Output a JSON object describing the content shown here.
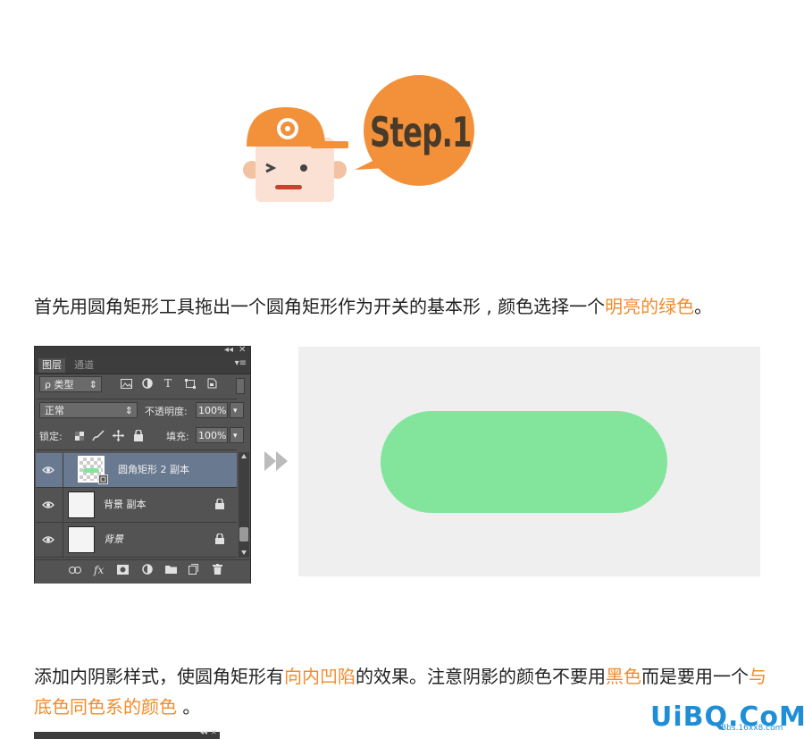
{
  "header": {
    "bubble_text": "Step.1"
  },
  "paragraph1": {
    "text_before": "首先用圆角矩形工具拖出一个圆角矩形作为开关的基本形 , 颜色选择一个",
    "highlight": "明亮的绿色",
    "text_after": "。"
  },
  "paragraph2": {
    "part1": "添加内阴影样式，使圆角矩形有",
    "hl1": "向内凹陷",
    "part2": "的效果。注意阴影的颜色不要用",
    "hl2": "黑色",
    "part3": "而是要用一个",
    "hl3": "与底色同色系的颜色",
    "part4": " 。"
  },
  "layers_panel": {
    "collapse_label": "◂◂",
    "close_label": "✕",
    "menu_label": "▾≡",
    "tabs": [
      {
        "label": "图层",
        "active": true
      },
      {
        "label": "通道",
        "active": false
      }
    ],
    "filter": {
      "label": "ρ 类型",
      "arrow": "⇕"
    },
    "filter_icons": [
      "image-filter-icon",
      "adjustment-filter-icon",
      "type-filter-icon",
      "shape-filter-icon",
      "smart-object-filter-icon"
    ],
    "type_glyph": "T",
    "blend_mode": "正常",
    "opacity_label": "不透明度:",
    "opacity_value": "100%",
    "lock_label": "锁定:",
    "fill_label": "填充:",
    "fill_value": "100%",
    "dropdown_glyph": "▾",
    "layers": [
      {
        "name": "圆角矩形 2 副本",
        "selected": true,
        "locked": false
      },
      {
        "name": "背景 副本",
        "selected": false,
        "locked": true
      },
      {
        "name": "背景",
        "selected": false,
        "locked": true
      }
    ],
    "bottom_icons": [
      "link-layers-icon",
      "fx-icon",
      "add-mask-icon",
      "adjustment-layer-icon",
      "new-group-icon",
      "new-layer-icon",
      "delete-layer-icon"
    ],
    "fx_label": "fx"
  },
  "canvas": {
    "shape_color": "#82e59b",
    "background_color": "#efefef"
  },
  "colors": {
    "accent_orange": "#f28b2b",
    "bubble_orange": "#f3913a"
  },
  "watermark": {
    "text": "UiBQ.CoM",
    "subtext": "Bbs.16xx8.com"
  }
}
